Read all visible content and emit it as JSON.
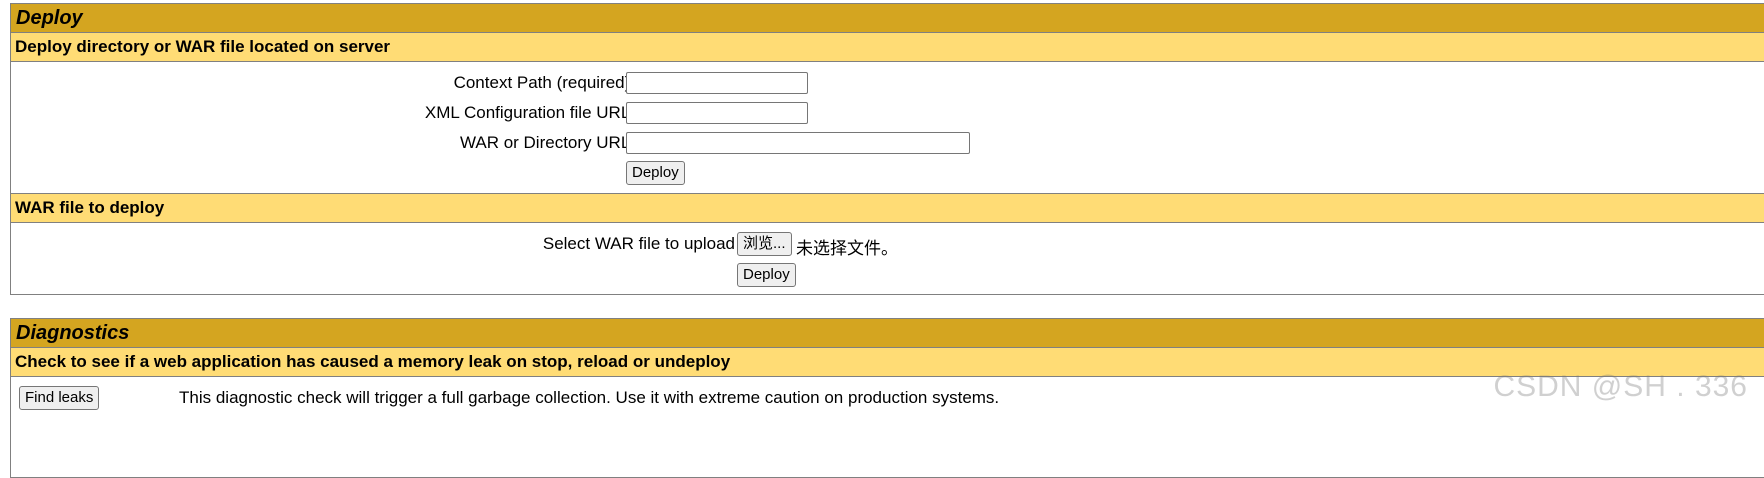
{
  "deploy": {
    "title": "Deploy",
    "server_section": {
      "header": "Deploy directory or WAR file located on server",
      "context_path_label": "Context Path (required):",
      "context_path_value": "",
      "xml_config_label": "XML Configuration file URL:",
      "xml_config_value": "",
      "war_dir_label": "WAR or Directory URL:",
      "war_dir_value": "",
      "deploy_button": "Deploy"
    },
    "upload_section": {
      "header": "WAR file to deploy",
      "select_label": "Select WAR file to upload",
      "browse_button": "浏览...",
      "no_file_text": "未选择文件。",
      "deploy_button": "Deploy"
    }
  },
  "diagnostics": {
    "title": "Diagnostics",
    "header": "Check to see if a web application has caused a memory leak on stop, reload or undeploy",
    "find_leaks_button": "Find leaks",
    "description": "This diagnostic check will trigger a full garbage collection. Use it with extreme caution on production systems."
  },
  "watermark": "CSDN @SH   . 336",
  "colors": {
    "title_bar": "#d4a520",
    "subheader_bar": "#ffdc75",
    "border": "#808080"
  }
}
